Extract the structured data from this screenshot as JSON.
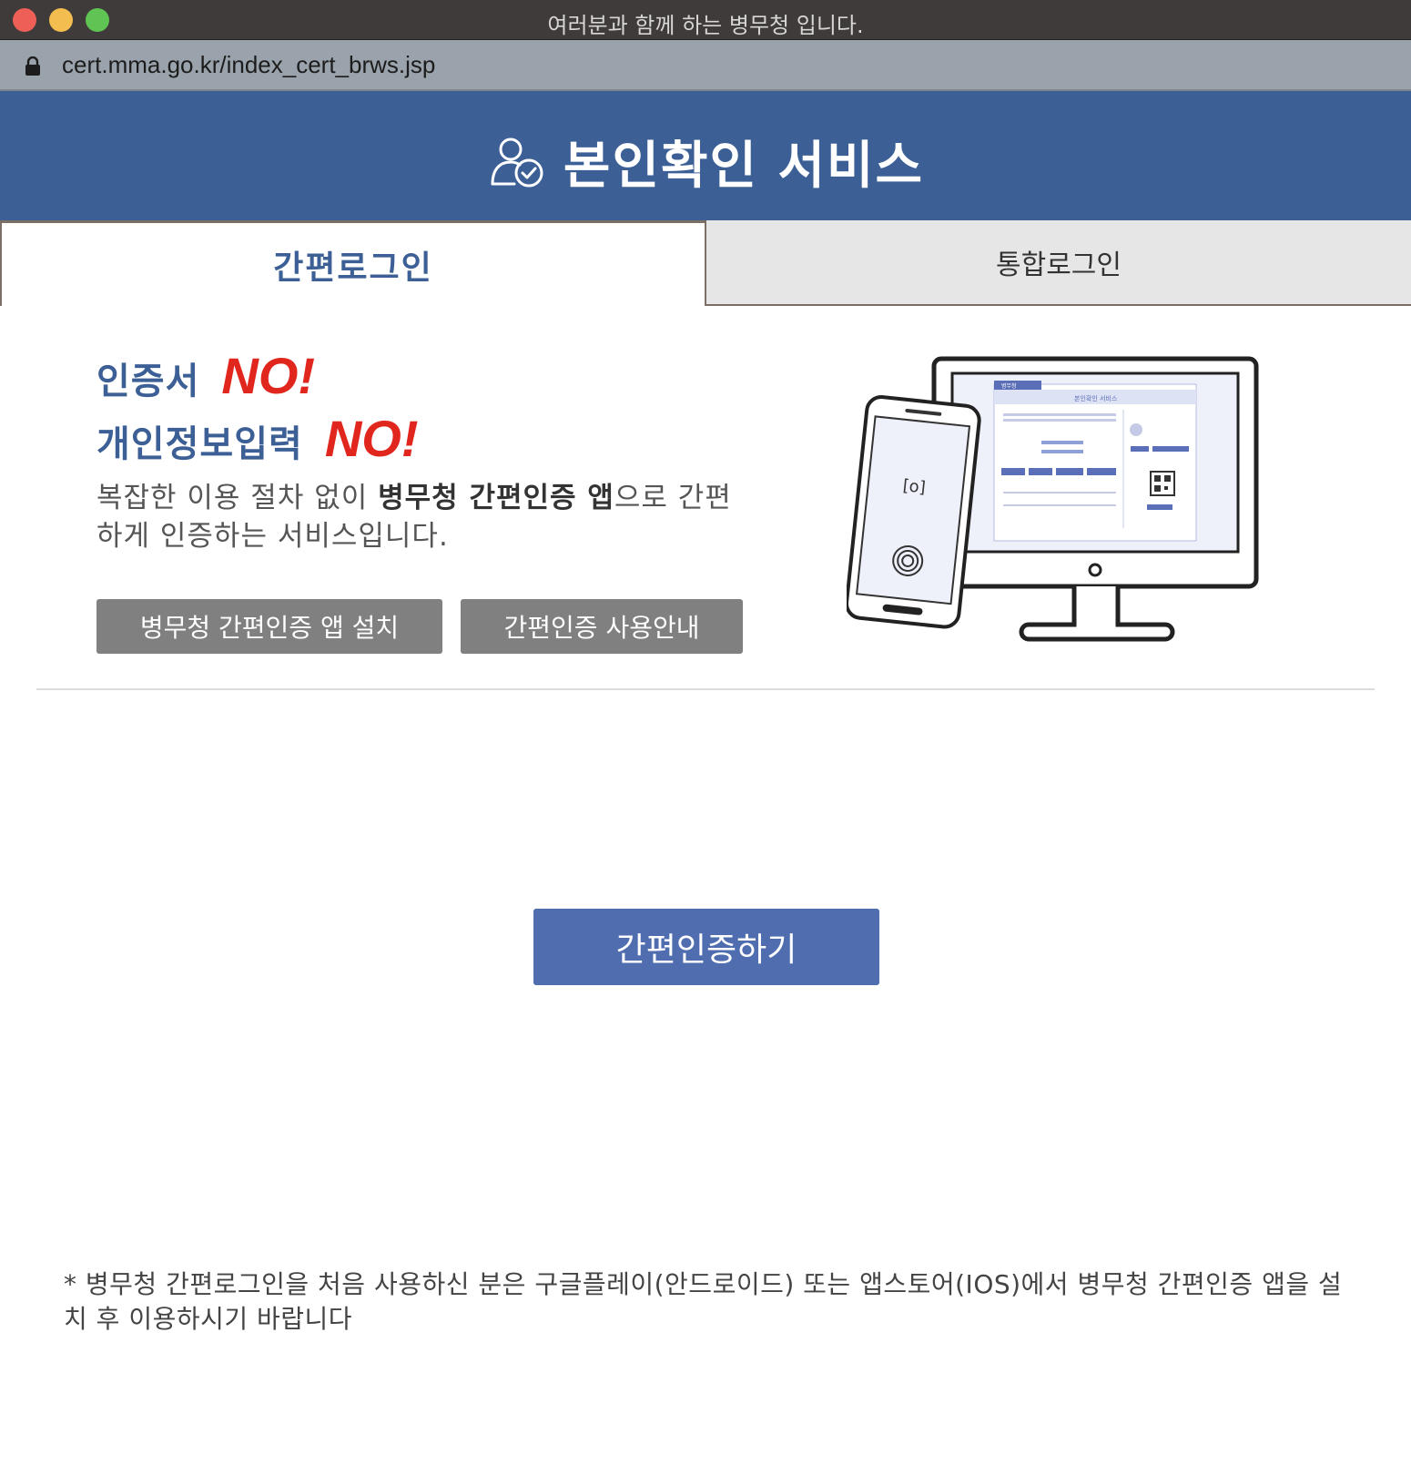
{
  "window": {
    "title": "여러분과 함께 하는 병무청 입니다.",
    "url": "cert.mma.go.kr/index_cert_brws.jsp"
  },
  "header": {
    "title": "본인확인 서비스",
    "icon": "user-check-icon"
  },
  "tabs": [
    {
      "label": "간편로그인",
      "active": true
    },
    {
      "label": "통합로그인",
      "active": false
    }
  ],
  "intro": {
    "line1_text": "인증서",
    "line1_no": "NO!",
    "line2_text": "개인정보입력",
    "line2_no": "NO!",
    "desc_part1": "복잡한 이용 절차 없이 ",
    "desc_bold": "병무청 간편인증 앱",
    "desc_part2": "으로 간편하게 인증하는 서비스입니다."
  },
  "buttons": {
    "install_app": "병무청 간편인증 앱 설치",
    "usage_guide": "간편인증 사용안내",
    "authenticate": "간편인증하기"
  },
  "illustration": {
    "screen_title": "본인확인 서비스",
    "screen_tab": "병무청"
  },
  "note": "* 병무청 간편로그인을 처음 사용하신 분은 구글플레이(안드로이드) 또는 앱스토어(IOS)에서 병무청 간편인증 앱을 설치 후 이용하시기 바랍니다",
  "colors": {
    "brand_blue": "#3c5f96",
    "button_blue": "#4f6daf",
    "accent_red": "#e0261d",
    "gray_button": "#808080"
  }
}
